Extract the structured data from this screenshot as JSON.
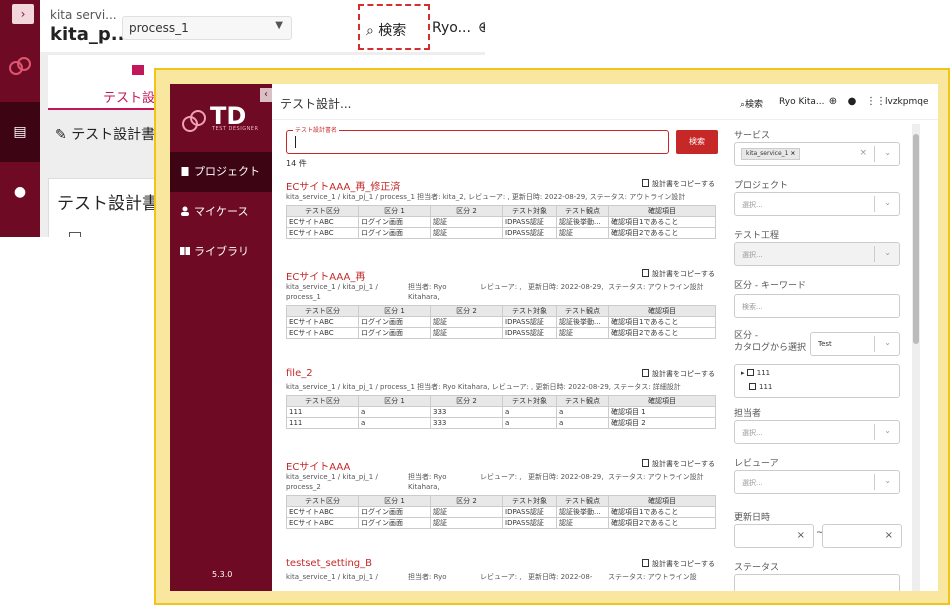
{
  "bg": {
    "service_name": "kita servi...",
    "project_name": "kita_p...",
    "process_select": "process_1",
    "search_label": "検索",
    "user": "Ryo...",
    "tab_label": "テスト設計",
    "edit_label": "テスト設計書",
    "card_title": "テスト設計書"
  },
  "sidebar": {
    "logo_text": "TD",
    "logo_sub": "TEST DESIGNER",
    "items": [
      {
        "label": "プロジェクト",
        "icon": "clipboard-icon"
      },
      {
        "label": "マイケース",
        "icon": "person-icon"
      },
      {
        "label": "ライブラリ",
        "icon": "book-icon"
      }
    ],
    "version": "5.3.0"
  },
  "topbar": {
    "title": "テスト設計...",
    "search_label": "検索",
    "user": "Ryo Kita...",
    "account_name": "lvzkpmqe"
  },
  "search": {
    "field_label": "テスト設計書名",
    "button_label": "検索",
    "count": "14 件"
  },
  "table_headers": [
    "テスト区分",
    "区分 1",
    "区分 2",
    "テスト対象",
    "テスト観点",
    "確認項目"
  ],
  "copy_label": "設計書をコピーする",
  "datasets": [
    {
      "title": "ECサイトAAA_再_修正済",
      "meta": "kita_service_1 / kita_pj_1 / process_1  担当者: kita_2,  レビューア: ,  更新日時: 2022-08-29,  ステータス: アウトライン設計",
      "rows": [
        [
          "ECサイトABC",
          "ログイン画面",
          "認証",
          "IDPASS認証",
          "認証後挙動...",
          "確認項目1であること"
        ],
        [
          "ECサイトABC",
          "ログイン画面",
          "認証",
          "IDPASS認証",
          "認証",
          "確認項目2であること"
        ]
      ]
    },
    {
      "title": "ECサイトAAA_再",
      "meta_path": "kita_service_1 / kita_pj_1 / process_1",
      "meta_owner": "担当者: Ryo Kitahara,",
      "meta_reviewer": "レビューア: ,",
      "meta_date": "更新日時: 2022-08-29,",
      "meta_status": "ステータス: アウトライン設計",
      "rows": [
        [
          "ECサイトABC",
          "ログイン画面",
          "認証",
          "IDPASS認証",
          "認証後挙動...",
          "確認項目1であること"
        ],
        [
          "ECサイトABC",
          "ログイン画面",
          "認証",
          "IDPASS認証",
          "認証",
          "確認項目2であること"
        ]
      ]
    },
    {
      "title": "file_2",
      "meta": "kita_service_1 / kita_pj_1 / process_1  担当者: Ryo Kitahara,  レビューア: ,  更新日時: 2022-08-29,  ステータス: 詳細設計",
      "rows": [
        [
          "111",
          "a",
          "333",
          "a",
          "a",
          "確認項目 1"
        ],
        [
          "111",
          "a",
          "333",
          "a",
          "a",
          "確認項目 2"
        ]
      ]
    },
    {
      "title": "ECサイトAAA",
      "meta_path": "kita_service_1 / kita_pj_1 / process_2",
      "meta_owner": "担当者: Ryo Kitahara,",
      "meta_reviewer": "レビューア: ,",
      "meta_date": "更新日時: 2022-08-29,",
      "meta_status": "ステータス: アウトライン設計",
      "rows": [
        [
          "ECサイトABC",
          "ログイン画面",
          "認証",
          "IDPASS認証",
          "認証後挙動...",
          "確認項目1であること"
        ],
        [
          "ECサイトABC",
          "ログイン画面",
          "認証",
          "IDPASS認証",
          "認証",
          "確認項目2であること"
        ]
      ]
    },
    {
      "title": "testset_setting_B",
      "meta_path": "kita_service_1 / kita_pj_1 /",
      "meta_owner": "担当者: Ryo",
      "meta_reviewer": "レビューア: ,",
      "meta_date": "更新日時: 2022-08-",
      "meta_status": "ステータス: アウトライン設"
    }
  ],
  "filters": {
    "service_label": "サービス",
    "service_chip": "kita_service_1",
    "project_label": "プロジェクト",
    "project_placeholder": "選択...",
    "process_label": "テスト工程",
    "process_placeholder": "選択...",
    "keyword_label": "区分 - キーワード",
    "keyword_placeholder": "検索...",
    "catalog_label_1": "区分 -",
    "catalog_label_2": "カタログから選択",
    "catalog_select": "Test",
    "tree_items": [
      "111",
      "111"
    ],
    "owner_label": "担当者",
    "owner_placeholder": "選択...",
    "reviewer_label": "レビューア",
    "reviewer_placeholder": "選択...",
    "date_label": "更新日時",
    "date_sep": "~",
    "status_label": "ステータス"
  },
  "colors": {
    "accent": "#c62828",
    "sidebar": "#6e0a23",
    "highlight": "#f0c419"
  }
}
